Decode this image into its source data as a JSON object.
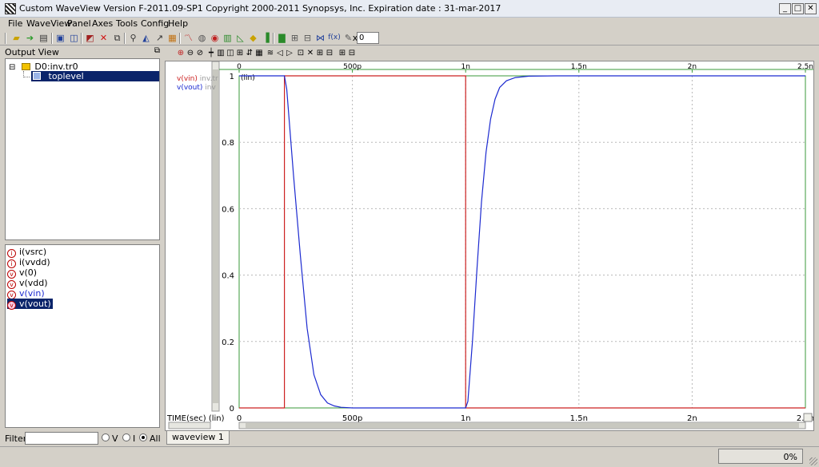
{
  "window": {
    "title": "Custom WaveView Version F-2011.09-SP1 Copyright 2000-2011 Synopsys, Inc.    Expiration date : 31-mar-2017",
    "minimize": "_",
    "maximize": "□",
    "close": "✕"
  },
  "menubar": [
    "File",
    "WaveView",
    "Panel",
    "Axes",
    "Tools",
    "Config",
    "Help"
  ],
  "toolbar": {
    "icons": [
      "open-icon",
      "import-icon",
      "print-icon",
      "save-icon",
      "save-all-icon",
      "close-wave-icon",
      "delete-icon",
      "copy-icon",
      "zoom-icon",
      "cursor-icon",
      "pen-icon",
      "grid-icon",
      "line-chart-icon",
      "globe-icon",
      "record-icon",
      "panel-icon",
      "area-chart-icon",
      "stack-icon",
      "histogram-icon",
      "bar-chart-icon",
      "calc-icon",
      "transform-icon",
      "scale-icon",
      "function-icon",
      "edit-icon"
    ],
    "function_label": "f(x)",
    "zoom_label": "x",
    "zoom_value": "0"
  },
  "output_view": {
    "title": "Output View",
    "tree": [
      {
        "label": "D0:inv.tr0",
        "level": 0,
        "expander": "⊟"
      },
      {
        "label": "toplevel",
        "level": 1,
        "selected": true
      }
    ],
    "signals": [
      {
        "label": "i(vsrc)",
        "kind": "i",
        "selected": false
      },
      {
        "label": "i(vvdd)",
        "kind": "i",
        "selected": false
      },
      {
        "label": "v(0)",
        "kind": "v",
        "selected": false
      },
      {
        "label": "v(vdd)",
        "kind": "v",
        "selected": false
      },
      {
        "label": "v(vin)",
        "kind": "v",
        "selected": false
      },
      {
        "label": "v(vout)",
        "kind": "v",
        "selected": true
      }
    ]
  },
  "filter": {
    "label": "Filter",
    "value": "",
    "options": [
      {
        "label": "V",
        "selected": false
      },
      {
        "label": "I",
        "selected": false
      },
      {
        "label": "All",
        "selected": true
      }
    ]
  },
  "graph_toolbar": [
    "zoom-in-icon",
    "zoom-out-icon",
    "zoom-fit-icon",
    "cursor-add-icon",
    "measure-icon",
    "ruler-icon",
    "align-icon",
    "marker-icon",
    "wave-icon",
    "prev-icon",
    "next-icon",
    "stack-icon",
    "delete-wave-icon",
    "group-icon",
    "table-icon"
  ],
  "chart_data": {
    "type": "line",
    "xlabel": "TIME(sec) (lin)",
    "ylabel": "(lin)",
    "xlim": [
      0,
      2.5e-09
    ],
    "ylim": [
      0,
      1
    ],
    "xticks": [
      0,
      5e-10,
      1e-09,
      1.5e-09,
      2e-09,
      2.5e-09
    ],
    "xticklabels": [
      "0",
      "500p",
      "1n",
      "1.5n",
      "2n",
      "2.5n"
    ],
    "yticks": [
      0,
      0.2,
      0.4,
      0.6,
      0.8,
      1
    ],
    "yticklabels": [
      "0",
      "0.2",
      "0.4",
      "0.6",
      "0.8",
      "1"
    ],
    "grid": true,
    "series": [
      {
        "name": "v(vin)",
        "file_label": "inv.tr",
        "color": "#cc2020",
        "x": [
          0,
          2e-10,
          2e-10,
          1e-09,
          1e-09,
          2.5e-09
        ],
        "y": [
          0,
          0,
          1,
          1,
          0,
          0
        ]
      },
      {
        "name": "v(vout)",
        "file_label": "inv",
        "color": "#1c2ad0",
        "x": [
          0,
          2e-10,
          2.1e-10,
          2.4e-10,
          2.7e-10,
          3e-10,
          3.3e-10,
          3.6e-10,
          3.9e-10,
          4.2e-10,
          4.5e-10,
          5e-10,
          1e-09,
          1.01e-09,
          1.03e-09,
          1.05e-09,
          1.07e-09,
          1.09e-09,
          1.11e-09,
          1.13e-09,
          1.15e-09,
          1.18e-09,
          1.22e-09,
          1.28e-09,
          1.4e-09,
          2.5e-09
        ],
        "y": [
          1,
          1,
          0.96,
          0.7,
          0.46,
          0.24,
          0.1,
          0.04,
          0.015,
          0.006,
          0.002,
          0.0,
          0.0,
          0.02,
          0.2,
          0.42,
          0.62,
          0.77,
          0.87,
          0.93,
          0.965,
          0.985,
          0.995,
          0.999,
          1.0,
          1.0
        ]
      }
    ]
  },
  "tabs": [
    {
      "label": "waveview 1",
      "active": true
    }
  ],
  "status": {
    "progress": "0%"
  }
}
